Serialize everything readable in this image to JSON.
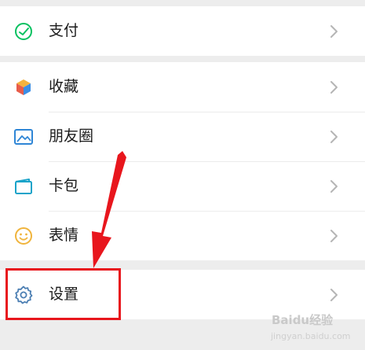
{
  "menu": {
    "pay": {
      "label": "支付",
      "icon": "pay-icon"
    },
    "favorites": {
      "label": "收藏",
      "icon": "favorites-icon"
    },
    "moments": {
      "label": "朋友圈",
      "icon": "moments-icon"
    },
    "cards": {
      "label": "卡包",
      "icon": "wallet-icon"
    },
    "stickers": {
      "label": "表情",
      "icon": "smiley-icon"
    },
    "settings": {
      "label": "设置",
      "icon": "gear-icon"
    }
  },
  "watermark": {
    "text": "Baidu经验",
    "sub": "jingyan.baidu.com"
  },
  "colors": {
    "pay": "#07c160",
    "moments": "#2f86d6",
    "cards": "#1aa3c9",
    "stickers": "#f0b43c",
    "settings": "#4c7fb3",
    "highlight": "#e8161d"
  }
}
